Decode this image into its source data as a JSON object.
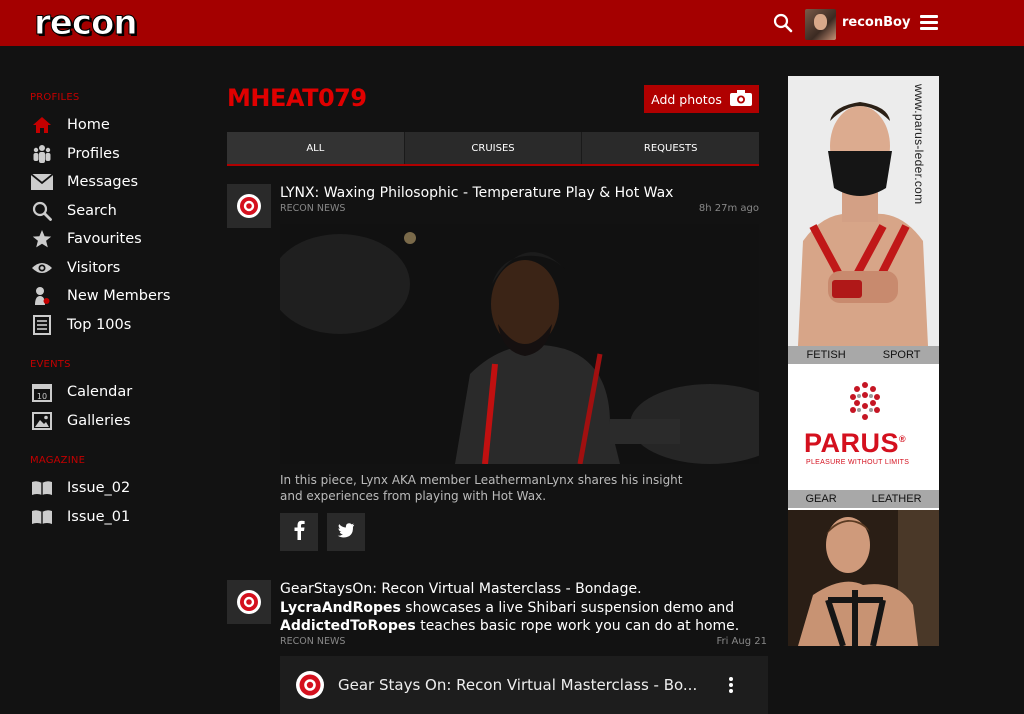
{
  "header": {
    "logo": "recon",
    "username": "reconBoy"
  },
  "sidebar": {
    "profiles_label": "PROFILES",
    "profiles": [
      {
        "label": "Home",
        "icon": "home-icon"
      },
      {
        "label": "Profiles",
        "icon": "profiles-icon"
      },
      {
        "label": "Messages",
        "icon": "envelope-icon"
      },
      {
        "label": "Search",
        "icon": "search-icon"
      },
      {
        "label": "Favourites",
        "icon": "star-icon"
      },
      {
        "label": "Visitors",
        "icon": "eye-icon"
      },
      {
        "label": "New Members",
        "icon": "new-member-icon"
      },
      {
        "label": "Top 100s",
        "icon": "list-icon"
      }
    ],
    "events_label": "EVENTS",
    "events": [
      {
        "label": "Calendar",
        "icon": "calendar-icon"
      },
      {
        "label": "Galleries",
        "icon": "image-icon"
      }
    ],
    "magazine_label": "MAGAZINE",
    "magazine": [
      {
        "label": "Issue_02",
        "icon": "book-icon"
      },
      {
        "label": "Issue_01",
        "icon": "book-icon"
      }
    ]
  },
  "main": {
    "title": "MHEAT079",
    "add_photos_label": "Add photos",
    "tabs": [
      "ALL",
      "CRUISES",
      "REQUESTS"
    ],
    "posts": [
      {
        "title": "LYNX: Waxing Philosophic - Temperature Play & Hot Wax",
        "source": "RECON NEWS",
        "time": "8h 27m ago",
        "description": "In this piece, Lynx AKA member LeathermanLynx shares his insight and experiences from playing with Hot Wax."
      },
      {
        "title_part1": "GearStaysOn: Recon Virtual Masterclass - Bondage.",
        "title_bold1": "LycraAndRopes",
        "title_part2": "showcases a live Shibari suspension demo and",
        "title_bold2": "AddictedToRopes",
        "title_part3": "teaches basic rope work you can do at home.",
        "source": "RECON NEWS",
        "time": "Fri Aug 21",
        "video_title": "Gear Stays On: Recon Virtual Masterclass - Bo..."
      }
    ]
  },
  "ad": {
    "url": "www.parus-leder.com",
    "bar1": [
      "FETISH",
      "SPORT"
    ],
    "brand": "PARUS",
    "registered": "®",
    "tagline": "PLEASURE WITHOUT LIMITS",
    "bar2": [
      "GEAR",
      "LEATHER"
    ]
  },
  "colors": {
    "brand_red": "#a40000",
    "accent_red": "#e00000",
    "background": "#121212"
  }
}
